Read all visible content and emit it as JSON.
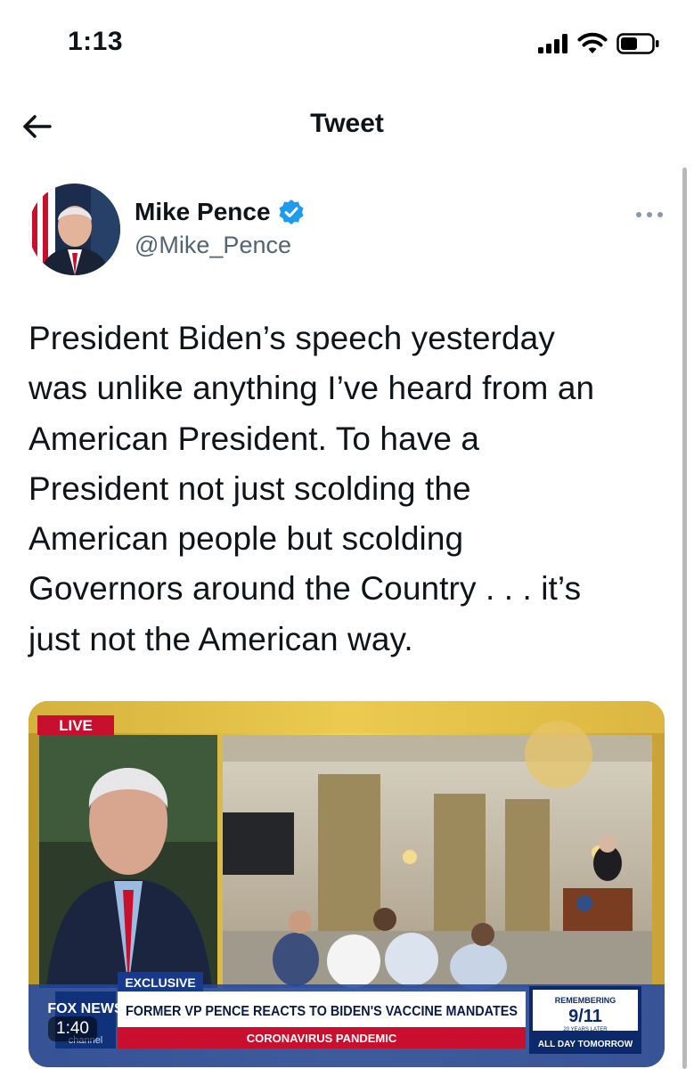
{
  "status_bar": {
    "time": "1:13"
  },
  "nav": {
    "title": "Tweet"
  },
  "tweet": {
    "author_name": "Mike Pence",
    "author_handle": "@Mike_Pence",
    "text": "President Biden’s speech yesterday\nwas unlike anything I’ve heard from an\nAmerican President. To have a\nPresident not just scolding the\nAmerican people but scolding\nGovernors around the Country . . . it’s\njust not the American way."
  },
  "video": {
    "duration": "1:40",
    "live_tag": "LIVE",
    "exclusive_tag": "EXCLUSIVE",
    "headline": "FORMER VP PENCE REACTS TO BIDEN'S VACCINE MANDATES",
    "subheadline": "CORONAVIRUS PANDEMIC",
    "side_top": "REMEMBERING",
    "side_main": "9/11",
    "side_small": "20 YEARS LATER",
    "side_bottom": "ALL DAY TOMORROW",
    "network": "FOX NEWS",
    "network_sub": "channel"
  },
  "colors": {
    "verified": "#1d9bf0",
    "text_secondary": "#536471",
    "live_red": "#c8102e",
    "banner_blue": "#173a8c"
  }
}
